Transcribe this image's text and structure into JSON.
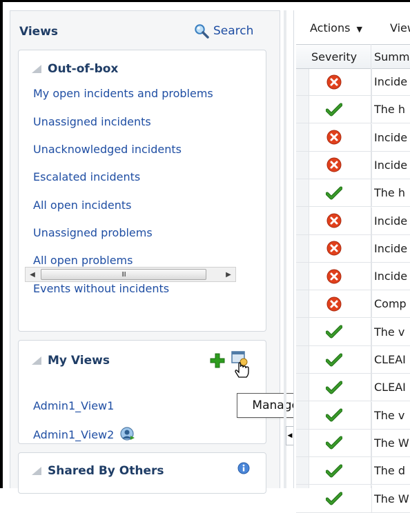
{
  "views_panel": {
    "title": "Views",
    "search_label": "Search",
    "out_of_box": {
      "title": "Out-of-box",
      "items": [
        "My open incidents and problems",
        "Unassigned incidents",
        "Unacknowledged incidents",
        "Escalated incidents",
        "All open incidents",
        "Unassigned problems",
        "All open problems",
        "Events without incidents"
      ],
      "scrollbar_thumb": "III"
    },
    "my_views": {
      "title": "My Views",
      "items": [
        "Admin1_View1",
        "Admin1_View2"
      ]
    },
    "shared_by_others": {
      "title": "Shared By Others"
    },
    "tooltip": "Manage ..."
  },
  "toolbar": {
    "actions_label": "Actions",
    "view_label": "View"
  },
  "table": {
    "columns": [
      "Severity",
      "Summary"
    ],
    "rows": [
      {
        "severity": "critical",
        "summary": "Incide"
      },
      {
        "severity": "clear",
        "summary": "The h"
      },
      {
        "severity": "critical",
        "summary": "Incide"
      },
      {
        "severity": "critical",
        "summary": "Incide"
      },
      {
        "severity": "clear",
        "summary": "The h"
      },
      {
        "severity": "critical",
        "summary": "Incide"
      },
      {
        "severity": "critical",
        "summary": "Incide"
      },
      {
        "severity": "critical",
        "summary": "Incide"
      },
      {
        "severity": "critical",
        "summary": "Comp"
      },
      {
        "severity": "clear",
        "summary": "The v"
      },
      {
        "severity": "clear",
        "summary": "CLEAI"
      },
      {
        "severity": "clear",
        "summary": "CLEAI"
      },
      {
        "severity": "clear",
        "summary": "The v"
      },
      {
        "severity": "clear",
        "summary": "The W"
      },
      {
        "severity": "clear",
        "summary": "The d"
      },
      {
        "severity": "clear",
        "summary": "The W"
      }
    ]
  },
  "colors": {
    "link": "#1f4ea3",
    "heading": "#1f3d66",
    "critical": "#e0401c",
    "clear": "#3a9a2a"
  },
  "icons": {
    "search": "magnifier-icon",
    "add_view": "plus-icon",
    "manage_views": "manage-views-icon",
    "shared_view": "shared-view-icon",
    "info": "info-icon",
    "critical": "critical-x-icon",
    "clear": "green-check-icon"
  }
}
